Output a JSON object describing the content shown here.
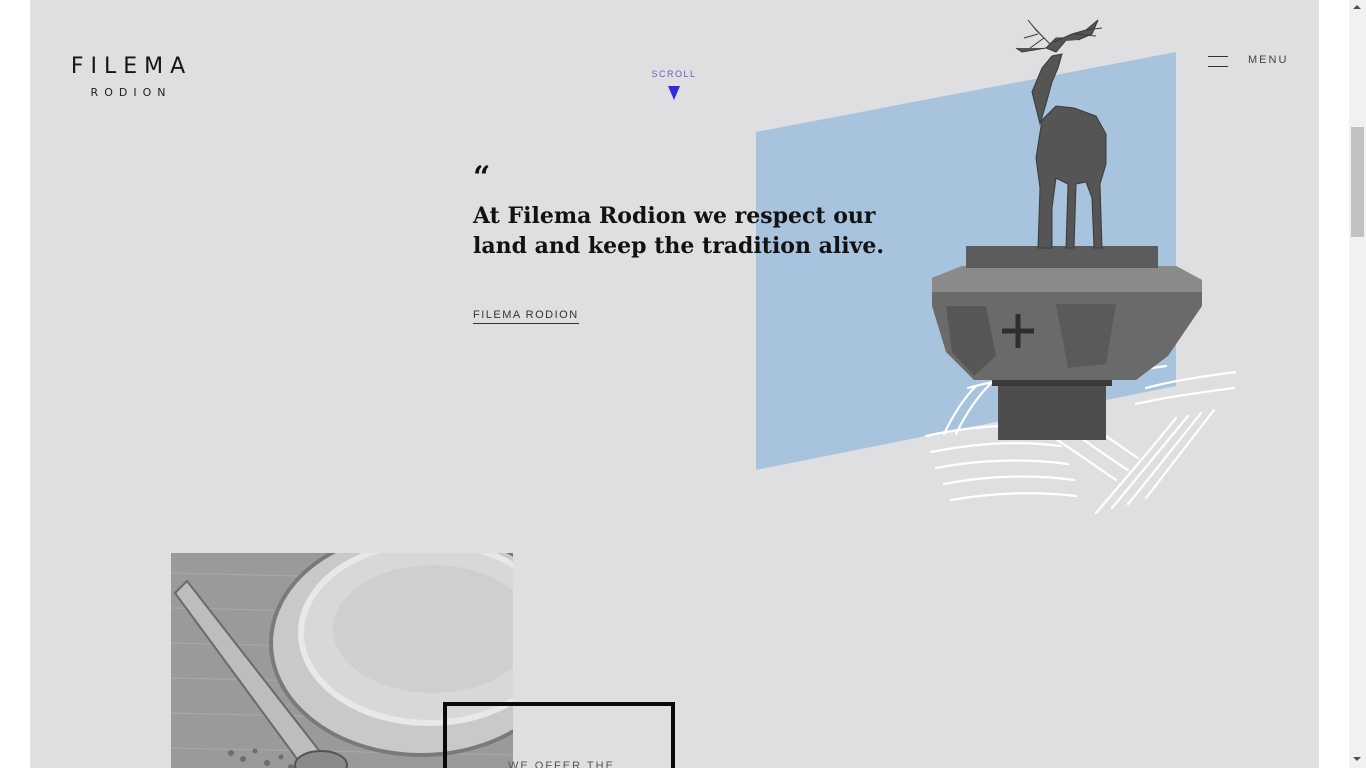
{
  "brand": {
    "name": "FILEMA",
    "subname": "RODION"
  },
  "nav": {
    "scroll_label": "SCROLL",
    "menu_label": "MENU"
  },
  "hero": {
    "quote_mark": "“",
    "quote": "At Filema Rodion we respect our land and keep the tradition alive.",
    "link_label": "FILEMA RODION"
  },
  "section2": {
    "offer_text": "WE OFFER THE"
  },
  "icons": {
    "scroll_arrow": "triangle-down-icon",
    "menu": "hamburger-icon"
  },
  "colors": {
    "page_bg": "#dfdfe1",
    "accent_blue": "#2d2dd6",
    "panel_blue": "#a8c3dd",
    "text_dark": "#121212"
  }
}
